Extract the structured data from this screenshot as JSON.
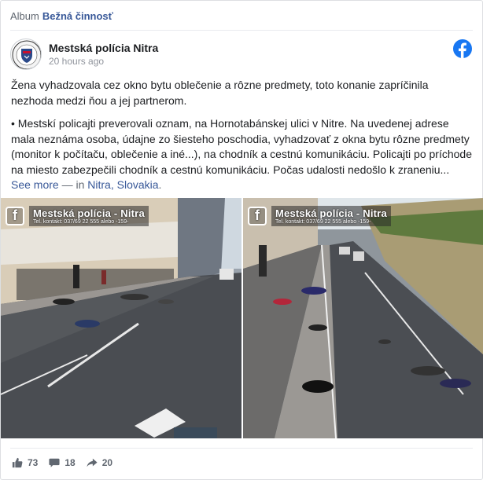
{
  "album": {
    "prefix": "Album",
    "name": "Bežná činnosť"
  },
  "post": {
    "author": "Mestská polícia Nitra",
    "timestamp": "20 hours ago",
    "paragraph1": "Žena vyhadzovala cez okno bytu oblečenie a rôzne predmety, toto konanie zapríčinila nezhoda medzi ňou a jej partnerom.",
    "paragraph2": "• Mestskí policajti preverovali oznam, na Hornotabánskej ulici v Nitre. Na uvedenej adrese mala neznáma osoba, údajne zo šiesteho poschodia, vyhadzovať z okna bytu rôzne predmety (monitor k počítaču, oblečenie a iné...), na chodník a cestnú komunikáciu. Policajti po príchode na miesto zabezpečili chodník a cestnú komunikáciu. Počas udalosti nedošlo k zraneniu...",
    "see_more": "See more",
    "in_label": " — in ",
    "location": "Nitra, Slovakia",
    "location_end": "."
  },
  "watermark": {
    "f": "f",
    "title": "Mestská polícia - Nitra",
    "subtitle": "Tel. kontakt: 037/69 22 555 alebo -159-"
  },
  "stats": {
    "likes": "73",
    "comments": "18",
    "shares": "20"
  },
  "colors": {
    "link": "#385898",
    "facebook": "#1877f2",
    "muted": "#606770"
  },
  "icons": {
    "brand": "facebook-icon",
    "like": "thumbs-up-icon",
    "comment": "comment-icon",
    "share": "share-icon"
  }
}
